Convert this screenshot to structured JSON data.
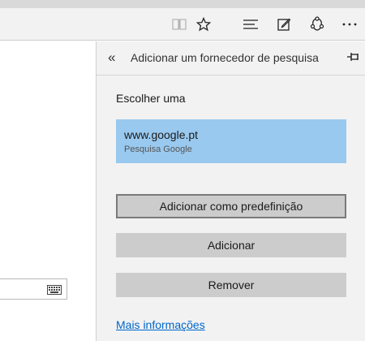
{
  "toolbar": {
    "icons": [
      "reading-view-icon",
      "favorite-star-icon",
      "hub-icon",
      "web-note-icon",
      "share-icon",
      "more-icon"
    ]
  },
  "panel": {
    "title": "Adicionar um fornecedor de pesquisa",
    "choose_label": "Escolher uma",
    "provider": {
      "url": "www.google.pt",
      "description": "Pesquisa Google"
    },
    "buttons": {
      "set_default": "Adicionar como predefinição",
      "add": "Adicionar",
      "remove": "Remover"
    },
    "more_info": "Mais informações"
  },
  "colors": {
    "selected_provider": "#99c9ef",
    "button_bg": "#cccccc",
    "panel_bg": "#f2f2f2",
    "link": "#0066cc"
  }
}
